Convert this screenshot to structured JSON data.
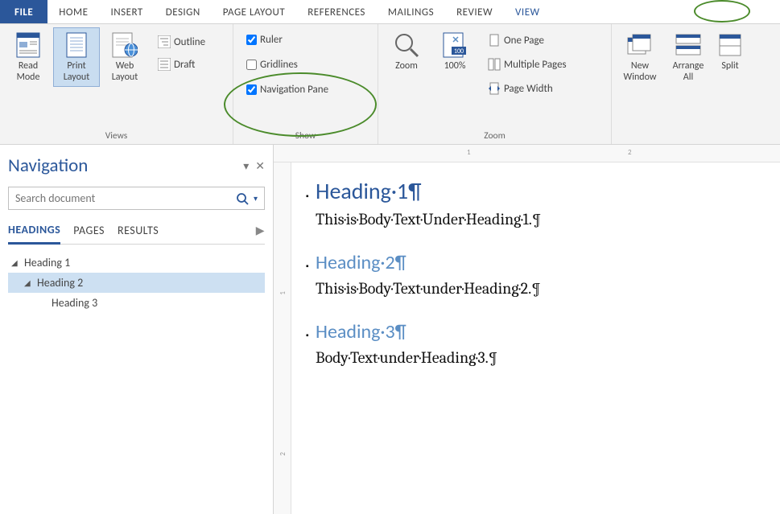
{
  "menu": {
    "file": "FILE",
    "tabs": [
      "HOME",
      "INSERT",
      "DESIGN",
      "PAGE LAYOUT",
      "REFERENCES",
      "MAILINGS",
      "REVIEW",
      "VIEW"
    ],
    "active": "VIEW"
  },
  "ribbon": {
    "views": {
      "label": "Views",
      "read_mode": "Read\nMode",
      "print_layout": "Print\nLayout",
      "web_layout": "Web\nLayout",
      "outline": "Outline",
      "draft": "Draft"
    },
    "show": {
      "label": "Show",
      "ruler": "Ruler",
      "gridlines": "Gridlines",
      "nav_pane": "Navigation Pane",
      "ruler_checked": true,
      "gridlines_checked": false,
      "nav_pane_checked": true
    },
    "zoom": {
      "label": "Zoom",
      "zoom_btn": "Zoom",
      "hundred": "100%",
      "one_page": "One Page",
      "multiple_pages": "Multiple Pages",
      "page_width": "Page Width"
    },
    "window": {
      "new_window": "New\nWindow",
      "arrange_all": "Arrange\nAll",
      "split": "Split"
    }
  },
  "nav_pane": {
    "title": "Navigation",
    "search_placeholder": "Search document",
    "tabs": {
      "headings": "HEADINGS",
      "pages": "PAGES",
      "results": "RESULTS"
    },
    "tree": {
      "h1": "Heading 1",
      "h2": "Heading 2",
      "h3": "Heading 3"
    }
  },
  "document": {
    "h1": "Heading·1¶",
    "body1": "This·is·Body·Text·Under·Heading·1.¶",
    "h2": "Heading·2¶",
    "body2": "This·is·Body·Text·under·Heading·2.¶",
    "h3": "Heading·3¶",
    "body3": "Body·Text·under·Heading·3.¶"
  },
  "ruler": {
    "h1": "1",
    "h2": "2",
    "v1": "1",
    "v2": "2"
  }
}
